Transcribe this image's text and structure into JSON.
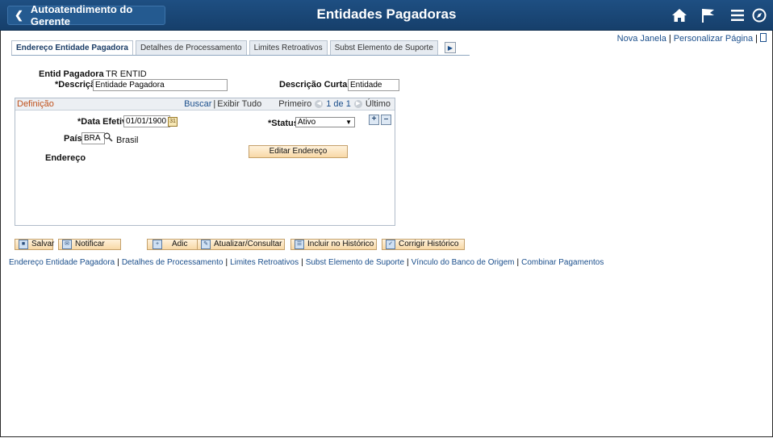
{
  "header": {
    "back_label": "Autoatendimento do Gerente",
    "title": "Entidades Pagadoras",
    "icons": [
      "home-icon",
      "flag-icon",
      "menu-icon",
      "navbar-icon"
    ]
  },
  "top_links": {
    "new_window": "Nova Janela",
    "personalize": "Personalizar Página"
  },
  "tabs": [
    {
      "label": "Endereço Entidade Pagadora",
      "active": true
    },
    {
      "label": "Detalhes de Processamento",
      "active": false
    },
    {
      "label": "Limites Retroativos",
      "active": false
    },
    {
      "label": "Subst Elemento de Suporte",
      "active": false
    }
  ],
  "form": {
    "entity_label": "Entid Pagadora",
    "entity_value": "TR ENTID",
    "description_label": "*Descrição",
    "description_value": "Entidade Pagadora",
    "short_desc_label": "Descrição Curta",
    "short_desc_value": "Entidade"
  },
  "grid": {
    "title": "Definição",
    "find": "Buscar",
    "view_all": "Exibir Tudo",
    "first": "Primeiro",
    "page_info": "1 de 1",
    "last": "Último",
    "eff_date_label": "*Data Efetiva",
    "eff_date_value": "01/01/1900",
    "status_label": "*Status",
    "status_value": "Ativo",
    "country_label": "País",
    "country_code": "BRA",
    "country_name": "Brasil",
    "address_label": "Endereço",
    "edit_address": "Editar Endereço"
  },
  "actions": {
    "save": "Salvar",
    "notify": "Notificar",
    "add": "Adic",
    "update": "Atualizar/Consultar",
    "include_history": "Incluir no Histórico",
    "correct_history": "Corrigir Histórico"
  },
  "bottom_links": [
    "Endereço Entidade Pagadora",
    "Detalhes de Processamento",
    "Limites Retroativos",
    "Subst Elemento de Suporte",
    "Vínculo do Banco de Origem",
    "Combinar Pagamentos"
  ],
  "colors": {
    "header_bg": "#1e4f82",
    "link": "#1b4f8c",
    "grid_title": "#c0501a",
    "button_bg": "#f8d8a6"
  }
}
